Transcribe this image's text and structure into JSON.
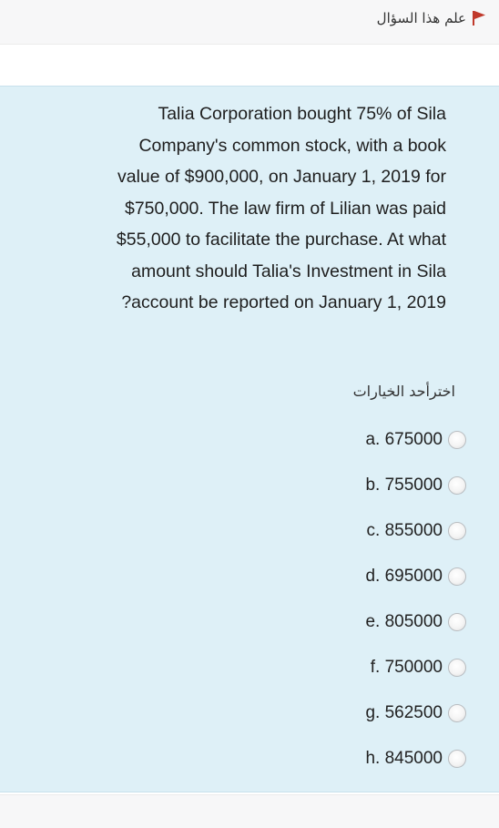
{
  "flag": {
    "label": "علم هذا السؤال",
    "icon": "flag-icon",
    "icon_color": "#c0392b"
  },
  "question": {
    "lines": [
      "Talia Corporation bought 75% of Sila",
      "Company's common stock, with a book",
      "value of $900,000, on January 1, 2019 for",
      "$750,000. The law firm of Lilian was paid",
      "$55,000 to facilitate the purchase. At what",
      "amount should Talia's Investment in Sila",
      "?account be reported on January 1, 2019"
    ],
    "background_color": "#def0f7"
  },
  "answer": {
    "prompt": "اخترأحد الخيارات",
    "options": [
      {
        "label": "a. 675000",
        "selected": false
      },
      {
        "label": "b. 755000",
        "selected": false
      },
      {
        "label": "c. 855000",
        "selected": false
      },
      {
        "label": "d. 695000",
        "selected": false
      },
      {
        "label": "e. 805000",
        "selected": false
      },
      {
        "label": "f. 750000",
        "selected": false
      },
      {
        "label": "g. 562500",
        "selected": false
      },
      {
        "label": "h. 845000",
        "selected": false
      }
    ]
  }
}
